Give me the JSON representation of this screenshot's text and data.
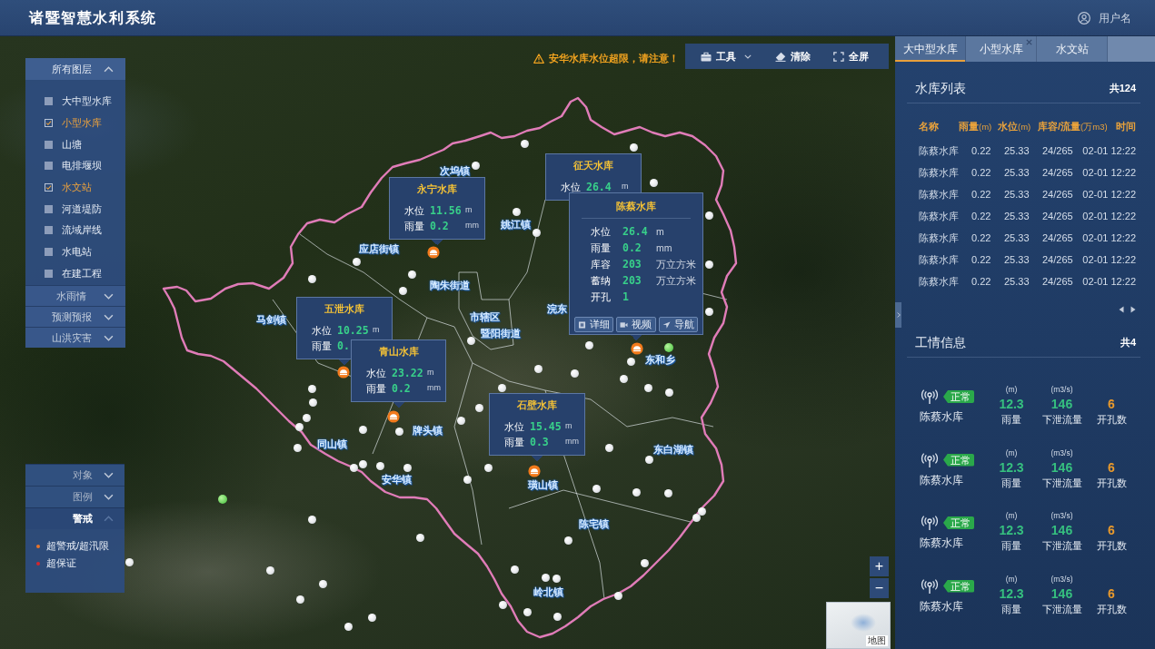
{
  "header": {
    "title": "诸暨智慧水利系统",
    "user": "用户名"
  },
  "layer_panel": {
    "sections": [
      {
        "label": "所有图层",
        "expanded": true,
        "items": [
          {
            "label": "大中型水库",
            "checked": false
          },
          {
            "label": "小型水库",
            "checked": true
          },
          {
            "label": "山塘",
            "checked": false
          },
          {
            "label": "电排堰坝",
            "checked": false
          },
          {
            "label": "水文站",
            "checked": true
          },
          {
            "label": "河道堤防",
            "checked": false
          },
          {
            "label": "流域岸线",
            "checked": false
          },
          {
            "label": "水电站",
            "checked": false
          },
          {
            "label": "在建工程",
            "checked": false
          }
        ]
      },
      {
        "label": "水雨情",
        "expanded": false
      },
      {
        "label": "预测预报",
        "expanded": false
      },
      {
        "label": "山洪灾害",
        "expanded": false
      }
    ]
  },
  "alert": {
    "text": "安华水库水位超限，请注意！"
  },
  "map_toolbar": [
    {
      "label": "工具",
      "has_menu": true
    },
    {
      "label": "清除",
      "has_menu": false
    },
    {
      "label": "全屏",
      "has_menu": false
    }
  ],
  "map": {
    "place_labels": [
      "次坞镇",
      "姚江镇",
      "应店街镇",
      "陶朱街道",
      "浣东",
      "市辖区",
      "马剑镇",
      "暨阳街道",
      "东和乡",
      "牌头镇",
      "同山镇",
      "东白湖镇",
      "安华镇",
      "璜山镇",
      "陈宅镇",
      "岭北镇"
    ],
    "popups": [
      {
        "title": "永宁水库",
        "kind": "summary",
        "rows": [
          {
            "label": "水位",
            "value": "11.56",
            "unit": "m"
          },
          {
            "label": "雨量",
            "value": "0.2",
            "unit": "mm"
          }
        ]
      },
      {
        "title": "征天水库",
        "kind": "summary",
        "rows": [
          {
            "label": "水位",
            "value": "26.4",
            "unit": "m"
          }
        ]
      },
      {
        "title": "陈蔡水库",
        "kind": "detail",
        "rows": [
          {
            "label": "水位",
            "value": "26.4",
            "unit": "m"
          },
          {
            "label": "雨量",
            "value": "0.2",
            "unit": "mm"
          },
          {
            "label": "库容",
            "value": "203",
            "unit": "万立方米"
          },
          {
            "label": "蓄纳",
            "value": "203",
            "unit": "万立方米"
          },
          {
            "label": "开孔",
            "value": "1"
          }
        ],
        "actions": [
          "详细",
          "视频",
          "导航"
        ]
      },
      {
        "title": "五泄水库",
        "kind": "summary",
        "rows": [
          {
            "label": "水位",
            "value": "10.25",
            "unit": "m"
          },
          {
            "label": "雨量",
            "value": "0."
          }
        ]
      },
      {
        "title": "青山水库",
        "kind": "summary",
        "rows": [
          {
            "label": "水位",
            "value": "23.22",
            "unit": "m"
          },
          {
            "label": "雨量",
            "value": "0.2",
            "unit": "mm"
          }
        ]
      },
      {
        "title": "石壁水库",
        "kind": "summary",
        "rows": [
          {
            "label": "水位",
            "value": "15.45",
            "unit": "m"
          },
          {
            "label": "雨量",
            "value": "0.3",
            "unit": "mm"
          }
        ]
      }
    ],
    "zoom_controls": [
      "+",
      "−"
    ],
    "minimap_label": "地图"
  },
  "legend_panel": {
    "sections": [
      {
        "label": "对象",
        "expanded": false
      },
      {
        "label": "图例",
        "expanded": false
      },
      {
        "label": "警戒",
        "expanded": true,
        "items": [
          {
            "label": "超警戒/超汛限",
            "color": "#e8742a"
          },
          {
            "label": "超保证",
            "color": "#d3262e"
          }
        ]
      }
    ]
  },
  "right_panel": {
    "tabs": [
      {
        "label": "大中型水库",
        "selected": true,
        "closable": false
      },
      {
        "label": "小型水库",
        "selected": false,
        "closable": true
      },
      {
        "label": "水文站",
        "selected": false,
        "closable": false
      }
    ],
    "reservoir_list": {
      "title": "水库列表",
      "count": "共124",
      "columns": [
        {
          "label": "名称"
        },
        {
          "label": "雨量",
          "unit": "(m)"
        },
        {
          "label": "水位",
          "unit": "(m)"
        },
        {
          "label": "库容/流量",
          "unit": "(万m3)"
        },
        {
          "label": "时间"
        }
      ],
      "rows": [
        [
          "陈蔡水库",
          "0.22",
          "25.33",
          "24/265",
          "02-01 12:22"
        ],
        [
          "陈蔡水库",
          "0.22",
          "25.33",
          "24/265",
          "02-01 12:22"
        ],
        [
          "陈蔡水库",
          "0.22",
          "25.33",
          "24/265",
          "02-01 12:22"
        ],
        [
          "陈蔡水库",
          "0.22",
          "25.33",
          "24/265",
          "02-01 12:22"
        ],
        [
          "陈蔡水库",
          "0.22",
          "25.33",
          "24/265",
          "02-01 12:22"
        ],
        [
          "陈蔡水库",
          "0.22",
          "25.33",
          "24/265",
          "02-01 12:22"
        ],
        [
          "陈蔡水库",
          "0.22",
          "25.33",
          "24/265",
          "02-01 12:22"
        ]
      ]
    },
    "work_info": {
      "title": "工情信息",
      "count": "共4",
      "items": [
        {
          "name": "陈蔡水库",
          "status": "正常",
          "metrics": [
            {
              "unit": "(m)",
              "value": "12.3",
              "label": "雨量",
              "color": "#36c07f"
            },
            {
              "unit": "(m3/s)",
              "value": "146",
              "label": "下泄流量",
              "color": "#36c07f"
            },
            {
              "value": "6",
              "label": "开孔数",
              "color": "#e8992c"
            }
          ]
        },
        {
          "name": "陈蔡水库",
          "status": "正常",
          "metrics": [
            {
              "unit": "(m)",
              "value": "12.3",
              "label": "雨量",
              "color": "#36c07f"
            },
            {
              "unit": "(m3/s)",
              "value": "146",
              "label": "下泄流量",
              "color": "#36c07f"
            },
            {
              "value": "6",
              "label": "开孔数",
              "color": "#e8992c"
            }
          ]
        },
        {
          "name": "陈蔡水库",
          "status": "正常",
          "metrics": [
            {
              "unit": "(m)",
              "value": "12.3",
              "label": "雨量",
              "color": "#36c07f"
            },
            {
              "unit": "(m3/s)",
              "value": "146",
              "label": "下泄流量",
              "color": "#36c07f"
            },
            {
              "value": "6",
              "label": "开孔数",
              "color": "#e8992c"
            }
          ]
        },
        {
          "name": "陈蔡水库",
          "status": "正常",
          "metrics": [
            {
              "unit": "(m)",
              "value": "12.3",
              "label": "雨量",
              "color": "#36c07f"
            },
            {
              "unit": "(m3/s)",
              "value": "146",
              "label": "下泄流量",
              "color": "#36c07f"
            },
            {
              "value": "6",
              "label": "开孔数",
              "color": "#e8992c"
            }
          ]
        }
      ]
    }
  }
}
